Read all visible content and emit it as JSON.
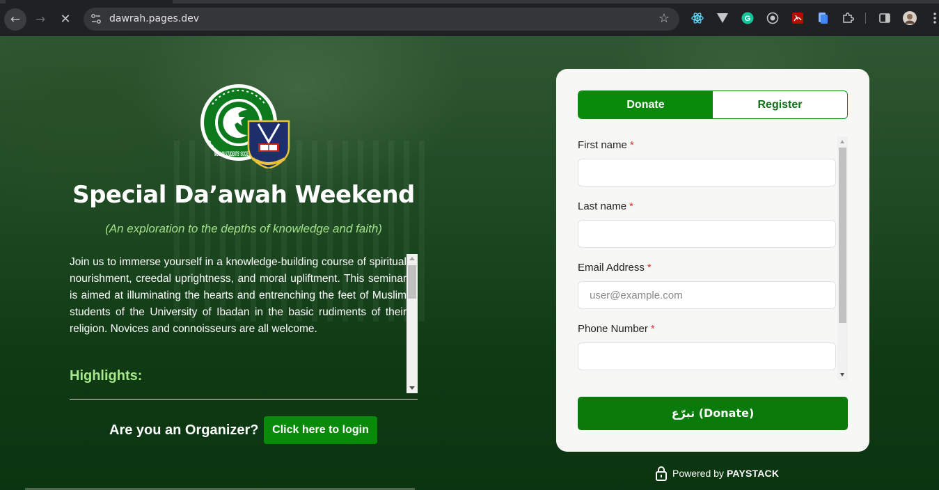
{
  "browser": {
    "url": "dawrah.pages.dev",
    "back_glyph": "←",
    "forward_glyph": "→",
    "stop_glyph": "✕",
    "star_glyph": "☆"
  },
  "event": {
    "title": "Special Da’awah Weekend",
    "subtitle": "(An exploration to the depths of knowledge and faith)",
    "description": "Join us to immerse yourself in a knowledge-building course of spiritual nourishment, creedal uprightness, and moral upliftment. This seminar is aimed at illuminating the hearts and entrenching the feet of Muslim students of the University of Ibadan in the basic rudiments of their religion. Novices and connoisseurs are all welcome.",
    "highlights_heading": "Highlights:",
    "logo_text": "MUSLIM STUDENTS' SOCIETY NIGERIA"
  },
  "organizer": {
    "question": "Are you an Organizer?",
    "login_label": "Click here to login"
  },
  "card": {
    "tabs": [
      {
        "label": "Donate",
        "active": true
      },
      {
        "label": "Register",
        "active": false
      }
    ],
    "fields": [
      {
        "label": "First name",
        "required_mark": "*",
        "value": "",
        "placeholder": ""
      },
      {
        "label": "Last name",
        "required_mark": "*",
        "value": "",
        "placeholder": ""
      },
      {
        "label": "Email Address",
        "required_mark": "*",
        "value": "",
        "placeholder": "user@example.com"
      },
      {
        "label": "Phone Number",
        "required_mark": "*",
        "value": "",
        "placeholder": ""
      }
    ],
    "submit_label": "تبرّع (Donate)"
  },
  "footer": {
    "powered_by": "Powered by",
    "brand": "PAYSTACK"
  },
  "colors": {
    "primary_green": "#0a8a0a",
    "highlight_green": "#a8e88c",
    "required_red": "#d32f2f"
  }
}
